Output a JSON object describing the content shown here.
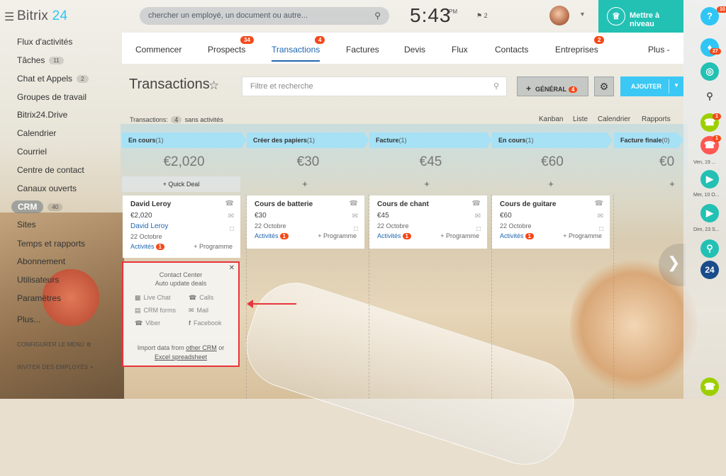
{
  "app": {
    "logo_main": "Bitrix",
    "logo_num": "24"
  },
  "search": {
    "placeholder": "chercher un employé, un document ou autre..."
  },
  "clock": {
    "time": "5:43",
    "ampm": "PM",
    "flag_count": "2"
  },
  "upgrade": {
    "label": "Mettre à niveau"
  },
  "left_menu": {
    "items": [
      {
        "label": "Flux d'activités"
      },
      {
        "label": "Tâches",
        "count": "11"
      },
      {
        "label": "Chat et Appels",
        "count": "2"
      },
      {
        "label": "Groupes de travail"
      },
      {
        "label": "Bitrix24.Drive"
      },
      {
        "label": "Calendrier"
      },
      {
        "label": "Courriel"
      },
      {
        "label": "Centre de contact"
      },
      {
        "label": "Canaux ouverts"
      },
      {
        "label": "CRM",
        "count": "40"
      },
      {
        "label": "Sites"
      },
      {
        "label": "Temps et rapports"
      },
      {
        "label": "Abonnement"
      },
      {
        "label": "Utilisateurs"
      },
      {
        "label": "Paramètres"
      },
      {
        "label": "Plus..."
      }
    ],
    "configure": "CONFIGURER LE MENU",
    "invite": "INVITER DES EMPLOYÉS"
  },
  "tabs": [
    {
      "label": "Commencer"
    },
    {
      "label": "Prospects",
      "badge": "34"
    },
    {
      "label": "Transactions",
      "badge": "4"
    },
    {
      "label": "Factures"
    },
    {
      "label": "Devis"
    },
    {
      "label": "Flux"
    },
    {
      "label": "Contacts"
    },
    {
      "label": "Entreprises",
      "badge": "2"
    },
    {
      "label": "Plus -"
    }
  ],
  "page": {
    "title": "Transactions",
    "filter_placeholder": "Filtre et recherche",
    "general_label": "GÉNÉRAL",
    "general_badge": "4",
    "add_label": "AJOUTER",
    "sub_prefix": "Transactions:",
    "sub_count": "4",
    "sub_suffix": "sans activités",
    "views": [
      "Kanban",
      "Liste",
      "Calendrier",
      "Rapports"
    ]
  },
  "stages": [
    {
      "name": "En cours",
      "count": "(1)",
      "amount": "€2,020"
    },
    {
      "name": "Créer des papiers",
      "count": "(1)",
      "amount": "€30"
    },
    {
      "name": "Facture",
      "count": "(1)",
      "amount": "€45"
    },
    {
      "name": "En cours",
      "count": "(1)",
      "amount": "€60"
    },
    {
      "name": "Facture finale",
      "count": "(0)",
      "amount": "€0"
    }
  ],
  "quick_deal": "Quick Deal",
  "cards": [
    {
      "name": "David Leroy",
      "price": "€2,020",
      "contact": "David Leroy",
      "date": "22 Octobre",
      "activities": "Activités",
      "act_badge": "1",
      "program": "+ Programme"
    },
    {
      "name": "Cours de batterie",
      "price": "€30",
      "date": "22 Octobre",
      "activities": "Activités",
      "act_badge": "1",
      "program": "+ Programme"
    },
    {
      "name": "Cours de chant",
      "price": "€45",
      "date": "22 Octobre",
      "activities": "Activités",
      "act_badge": "1",
      "program": "+ Programme"
    },
    {
      "name": "Cours de guitare",
      "price": "€60",
      "date": "22 Octobre",
      "activities": "Activités",
      "act_badge": "1",
      "program": "+ Programme"
    }
  ],
  "contact_center": {
    "title": "Contact Center",
    "subtitle": "Auto update deals",
    "options": [
      "Live Chat",
      "Calls",
      "CRM forms",
      "Mail",
      "Viber",
      "Facebook"
    ],
    "import_prefix": "Import data from",
    "other_crm": "other CRM",
    "or": "or",
    "excel": "Excel spreadsheet"
  },
  "rail": {
    "help_badge": "10",
    "notif_badge": "27",
    "call1_badge": "1",
    "call2_badge": "1",
    "date1": "Ven, 19 ...",
    "date2": "Mer, 10 O...",
    "date3": "Dim, 23 S...",
    "b24": "24"
  },
  "colors": {
    "accent": "#2067b0",
    "stage": "#a6e1f6",
    "upgrade": "#22c1b4",
    "add": "#3bc8f5",
    "badge": "#f54819",
    "highlight": "#e8353b"
  }
}
